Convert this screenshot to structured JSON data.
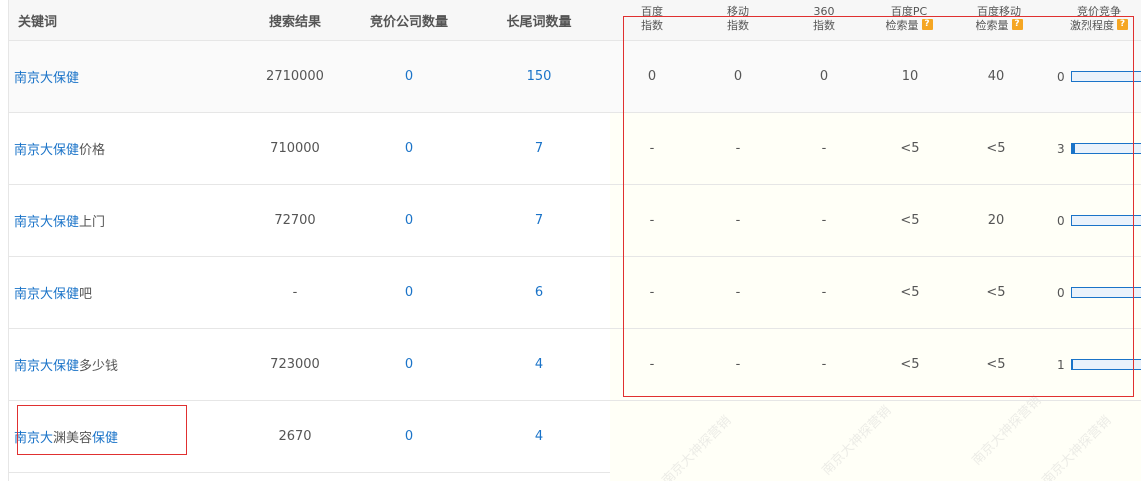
{
  "headers": {
    "keyword": "关键词",
    "results": "搜索结果",
    "bid_companies": "竞价公司数量",
    "longtail": "长尾词数量",
    "baidu_index_l1": "百度",
    "baidu_index_l2": "指数",
    "mobile_index_l1": "移动",
    "mobile_index_l2": "指数",
    "s360_index_l1": "360",
    "s360_index_l2": "指数",
    "pc_volume_l1": "百度PC",
    "pc_volume_l2": "检索量",
    "mobile_volume_l1": "百度移动",
    "mobile_volume_l2": "检索量",
    "competition_l1": "竞价竞争",
    "competition_l2": "激烈程度",
    "help_glyph": "?"
  },
  "rows": [
    {
      "kw_link": "南京大保健",
      "kw_rest": "",
      "kw_link2": "",
      "results": "2710000",
      "bid_companies": "0",
      "longtail": "150",
      "baidu_index": "0",
      "mobile_index": "0",
      "s360_index": "0",
      "pc_volume": "10",
      "mobile_volume": "40",
      "competition": "0",
      "competition_level": 0
    },
    {
      "kw_link": "南京大保健",
      "kw_rest": "价格",
      "kw_link2": "",
      "results": "710000",
      "bid_companies": "0",
      "longtail": "7",
      "baidu_index": "-",
      "mobile_index": "-",
      "s360_index": "-",
      "pc_volume": "<5",
      "mobile_volume": "<5",
      "competition": "3",
      "competition_level": 3
    },
    {
      "kw_link": "南京大保健",
      "kw_rest": "上门",
      "kw_link2": "",
      "results": "72700",
      "bid_companies": "0",
      "longtail": "7",
      "baidu_index": "-",
      "mobile_index": "-",
      "s360_index": "-",
      "pc_volume": "<5",
      "mobile_volume": "20",
      "competition": "0",
      "competition_level": 0
    },
    {
      "kw_link": "南京大保健",
      "kw_rest": "吧",
      "kw_link2": "",
      "results": "-",
      "bid_companies": "0",
      "longtail": "6",
      "baidu_index": "-",
      "mobile_index": "-",
      "s360_index": "-",
      "pc_volume": "<5",
      "mobile_volume": "<5",
      "competition": "0",
      "competition_level": 0
    },
    {
      "kw_link": "南京大保健",
      "kw_rest": "多少钱",
      "kw_link2": "",
      "results": "723000",
      "bid_companies": "0",
      "longtail": "4",
      "baidu_index": "-",
      "mobile_index": "-",
      "s360_index": "-",
      "pc_volume": "<5",
      "mobile_volume": "<5",
      "competition": "1",
      "competition_level": 1
    },
    {
      "kw_link": "南京大",
      "kw_rest": "渊美容",
      "kw_link2": "保健",
      "results": "2670",
      "bid_companies": "0",
      "longtail": "4"
    }
  ],
  "colors": {
    "link": "#1a73c8",
    "highlight_box": "#e03030",
    "help_badge": "#f5a623"
  }
}
